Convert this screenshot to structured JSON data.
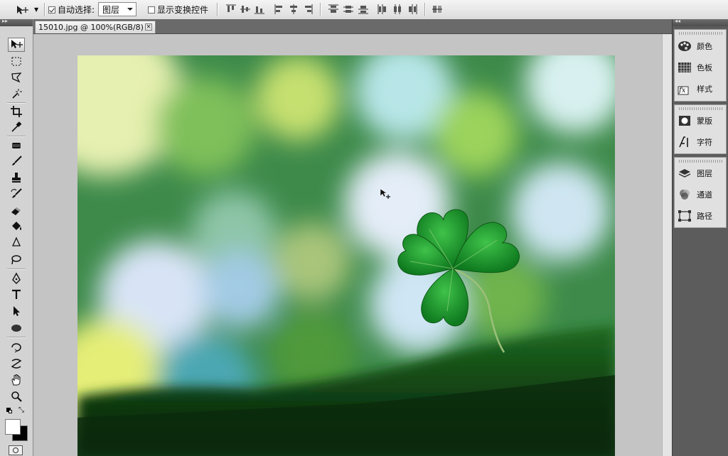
{
  "options_bar": {
    "auto_select_label": "自动选择:",
    "auto_select_checked": true,
    "auto_select_value": "图层",
    "show_transform_label": "显示变换控件",
    "show_transform_checked": false
  },
  "document": {
    "tab_title": "15010.jpg @ 100%(RGB/8)",
    "close_symbol": "×"
  },
  "tools": [
    {
      "name": "move-tool-icon",
      "active": true
    },
    {
      "name": "marquee-tool-icon"
    },
    {
      "name": "lasso-tool-icon"
    },
    {
      "name": "magic-wand-tool-icon"
    },
    {
      "name": "crop-tool-icon"
    },
    {
      "name": "eyedropper-tool-icon"
    },
    {
      "name": "healing-brush-tool-icon"
    },
    {
      "name": "brush-tool-icon"
    },
    {
      "name": "clone-stamp-tool-icon"
    },
    {
      "name": "history-brush-tool-icon"
    },
    {
      "name": "eraser-tool-icon"
    },
    {
      "name": "paint-bucket-tool-icon"
    },
    {
      "name": "blur-tool-icon"
    },
    {
      "name": "dodge-tool-icon"
    },
    {
      "name": "pen-tool-icon"
    },
    {
      "name": "type-tool-icon"
    },
    {
      "name": "path-selection-tool-icon"
    },
    {
      "name": "ellipse-tool-icon"
    },
    {
      "name": "3d-rotate-tool-icon"
    },
    {
      "name": "3d-orbit-tool-icon"
    },
    {
      "name": "hand-tool-icon"
    },
    {
      "name": "zoom-tool-icon"
    }
  ],
  "panels": {
    "color": "颜色",
    "swatches": "色板",
    "styles": "样式",
    "masks": "蒙版",
    "character": "字符",
    "layers": "图层",
    "channels": "通道",
    "paths": "路径"
  },
  "colors": {
    "foreground": "#000000",
    "background": "#ffffff",
    "clover": "#1f9a2c"
  }
}
